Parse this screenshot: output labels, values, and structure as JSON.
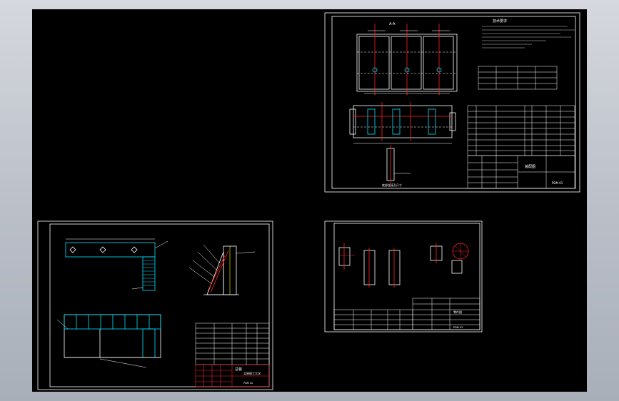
{
  "app": {
    "name": "CAD model space",
    "background_color": "#000000",
    "chrome_color": "#c0c4cc"
  },
  "sheets": [
    {
      "id": "sheet-a",
      "title_block": {
        "title": "装配图",
        "notes_title": "技术要求",
        "drawing_no": "PDM 01",
        "section_label": "A-A",
        "view_label": "底部连接孔尺寸"
      }
    },
    {
      "id": "sheet-b",
      "title_block": {
        "title": "总装",
        "company": "太原理工大学",
        "drawing_no": "PDM 02"
      }
    },
    {
      "id": "sheet-c",
      "title_block": {
        "title": "零件图",
        "drawing_no": "PDM 03"
      }
    }
  ],
  "colors": {
    "line_white": "#ffffff",
    "line_red": "#ff2020",
    "line_cyan": "#00e5ff",
    "line_yellow": "#ffff00",
    "line_green": "#00ff40"
  }
}
